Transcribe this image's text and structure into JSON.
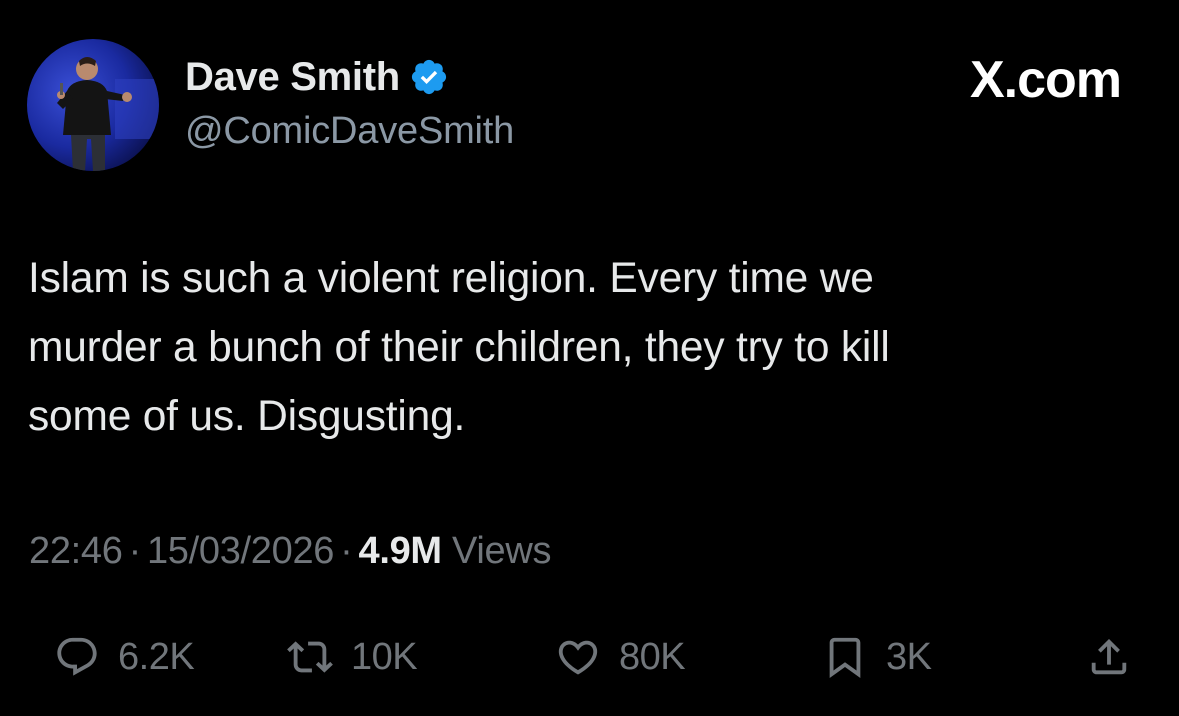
{
  "author": {
    "display_name": "Dave Smith",
    "handle": "@ComicDaveSmith",
    "verified_icon": "verified-badge-icon",
    "avatar": "avatar-photo"
  },
  "brand": {
    "label": "X.com"
  },
  "tweet": {
    "lines": [
      "Islam is such a violent religion. Every time we",
      "murder a bunch of their children, they try to kill",
      "some of us. Disgusting."
    ]
  },
  "meta": {
    "time": "22:46",
    "date": "15/03/2026",
    "separator": "·",
    "views_count": "4.9M",
    "views_label": "Views"
  },
  "actions": {
    "reply": {
      "icon": "reply-icon",
      "count": "6.2K"
    },
    "retweet": {
      "icon": "retweet-icon",
      "count": "10K"
    },
    "like": {
      "icon": "heart-icon",
      "count": "80K"
    },
    "bookmark": {
      "icon": "bookmark-icon",
      "count": "3K"
    },
    "share": {
      "icon": "share-icon"
    }
  },
  "colors": {
    "background": "#000000",
    "primary_text": "#e7e9ea",
    "secondary_text": "#71767b",
    "handle_text": "#8b98a5",
    "verified_blue": "#1d9bf0"
  }
}
